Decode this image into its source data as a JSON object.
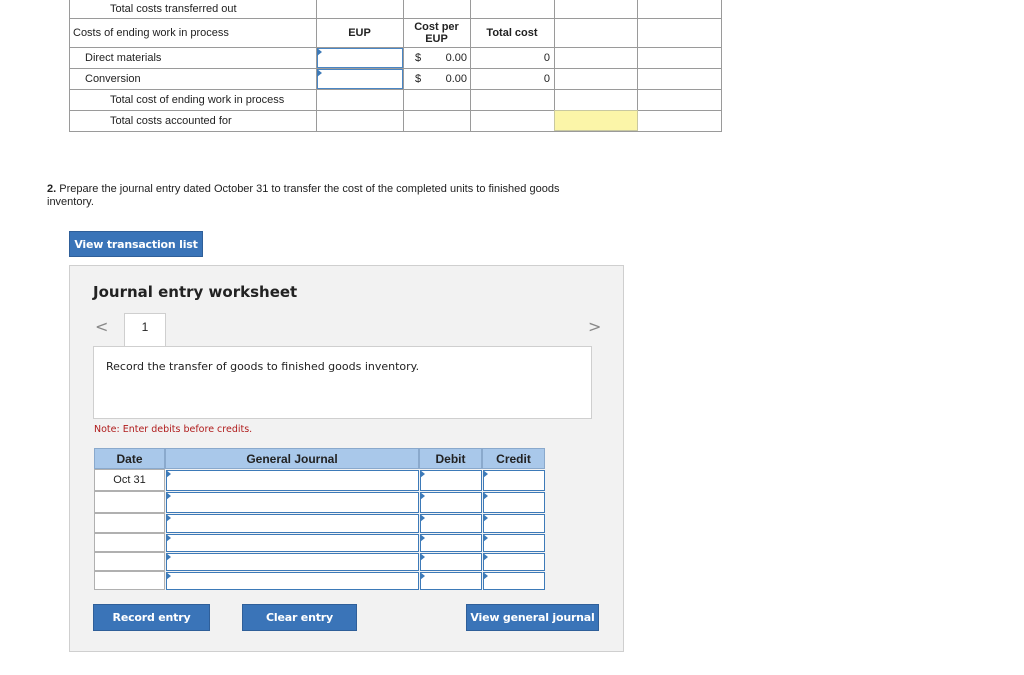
{
  "cost_table": {
    "row_transferred_label": "Total costs transferred out",
    "ending_wip_label": "Costs of ending work in process",
    "col_eup": "EUP",
    "col_cost_per_eup_line1": "Cost per",
    "col_cost_per_eup_line2": "EUP",
    "col_total_cost": "Total cost",
    "rows": [
      {
        "label": "Direct materials",
        "currency": "$",
        "cost_per_eup": "0.00",
        "total": "0"
      },
      {
        "label": "Conversion",
        "currency": "$",
        "cost_per_eup": "0.00",
        "total": "0"
      }
    ],
    "total_ending_label": "Total cost of ending work in process",
    "total_accounted_label": "Total costs accounted for"
  },
  "question": {
    "number": "2.",
    "text": "Prepare the journal entry dated October 31 to transfer the cost of the completed units to finished goods inventory."
  },
  "buttons": {
    "view_transaction_list": "View transaction list",
    "record_entry": "Record entry",
    "clear_entry": "Clear entry",
    "view_general_journal": "View general journal"
  },
  "worksheet": {
    "title": "Journal entry worksheet",
    "prev_arrow": "<",
    "next_arrow": ">",
    "tab_number": "1",
    "instruction": "Record the transfer of goods to finished goods inventory.",
    "note": "Note: Enter debits before credits.",
    "columns": {
      "date": "Date",
      "general_journal": "General Journal",
      "debit": "Debit",
      "credit": "Credit"
    },
    "first_date": "Oct 31"
  },
  "colors": {
    "button_blue": "#3a74b8",
    "header_blue": "#a9c8ea",
    "highlight_yellow": "#fbf5a8",
    "note_red": "#b01c1c"
  }
}
